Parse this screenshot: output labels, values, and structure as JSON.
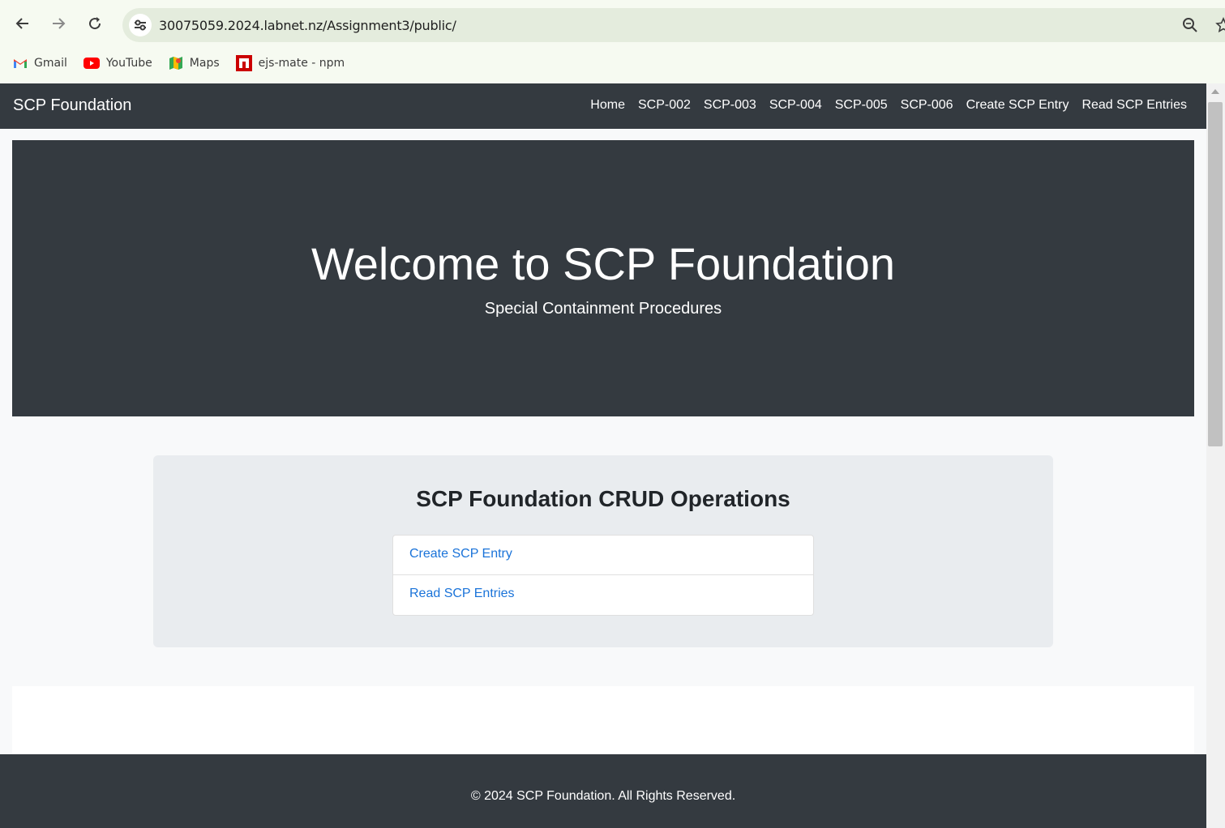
{
  "browser": {
    "url": "30075059.2024.labnet.nz/Assignment3/public/",
    "bookmarks": [
      {
        "label": "Gmail",
        "icon": "gmail-icon"
      },
      {
        "label": "YouTube",
        "icon": "youtube-icon"
      },
      {
        "label": "Maps",
        "icon": "maps-icon"
      },
      {
        "label": "ejs-mate - npm",
        "icon": "npm-icon"
      }
    ]
  },
  "navbar": {
    "brand": "SCP Foundation",
    "links": [
      "Home",
      "SCP-002",
      "SCP-003",
      "SCP-004",
      "SCP-005",
      "SCP-006",
      "Create SCP Entry",
      "Read SCP Entries"
    ]
  },
  "hero": {
    "title": "Welcome to SCP Foundation",
    "subtitle": "Special Containment Procedures"
  },
  "crud": {
    "heading": "SCP Foundation CRUD Operations",
    "items": [
      "Create SCP Entry",
      "Read SCP Entries"
    ]
  },
  "footer": {
    "text": "© 2024 SCP Foundation. All Rights Reserved."
  },
  "colors": {
    "dark": "#343a40",
    "link": "#1a73d9",
    "light_bg": "#f8f9fa",
    "panel_bg": "#e9ecef"
  }
}
